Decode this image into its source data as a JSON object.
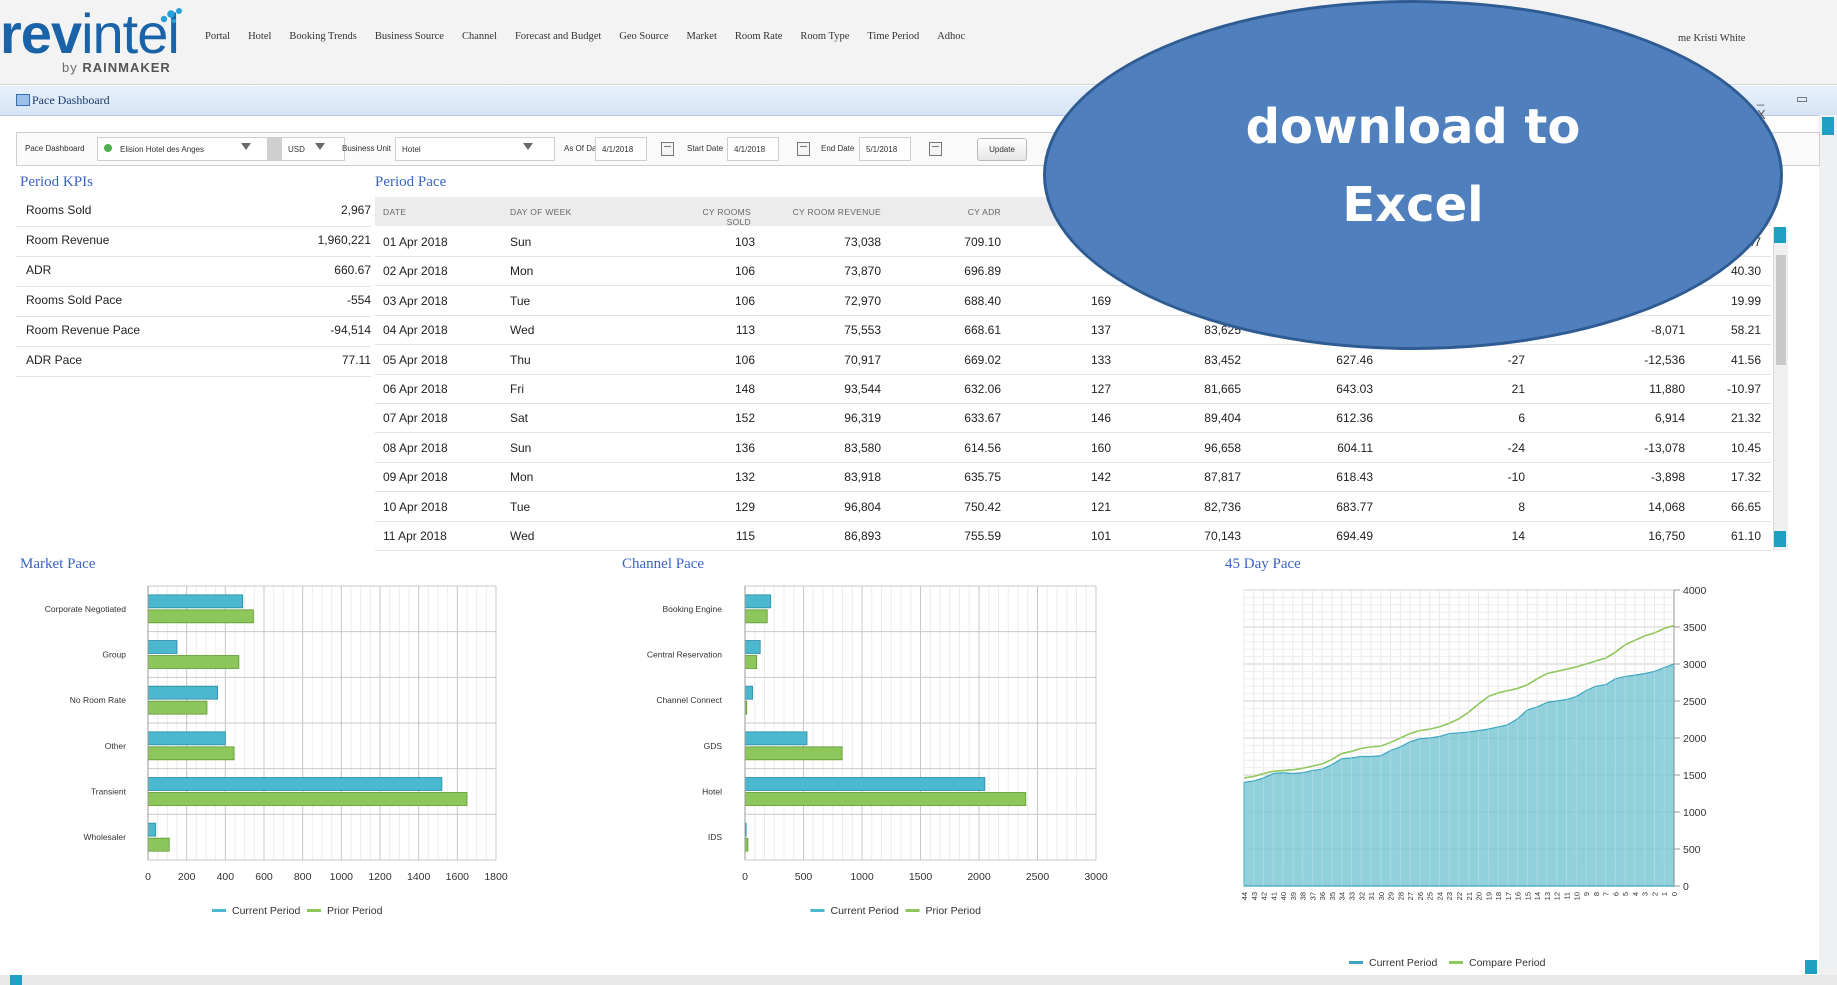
{
  "header": {
    "logo": {
      "brand_a": "rev",
      "brand_b": "intel",
      "by": "by",
      "company": "RAINMAKER"
    },
    "nav": [
      "Portal",
      "Hotel",
      "Booking Trends",
      "Business Source",
      "Channel",
      "Forecast and Budget",
      "Geo Source",
      "Market",
      "Room Rate",
      "Room Type",
      "Time Period",
      "Adhoc"
    ],
    "user": "me Kristi White"
  },
  "window": {
    "title": "Pace Dashboard",
    "controls": "_ ▭ X"
  },
  "filters": {
    "dashboard_label": "Pace Dashboard",
    "hotel": "Elision Hotel des Anges",
    "currency": "USD",
    "business_unit_label": "Business Unit",
    "business_unit": "Hotel",
    "as_of_label": "As Of Date",
    "as_of": "4/1/2018",
    "start_label": "Start Date",
    "start": "4/1/2018",
    "end_label": "End Date",
    "end": "5/1/2018",
    "update": "Update"
  },
  "callout": {
    "line1": "download to",
    "line2": "Excel"
  },
  "kpi": {
    "title": "Period KPIs",
    "rows": [
      {
        "k": "Rooms Sold",
        "v": "2,967"
      },
      {
        "k": "Room Revenue",
        "v": "1,960,221"
      },
      {
        "k": "ADR",
        "v": "660.67"
      },
      {
        "k": "Rooms Sold Pace",
        "v": "-554"
      },
      {
        "k": "Room Revenue Pace",
        "v": "-94,514"
      },
      {
        "k": "ADR Pace",
        "v": "77.11"
      }
    ]
  },
  "pace": {
    "title": "Period Pace",
    "headers": [
      "DATE",
      "DAY OF WEEK",
      "CY ROOMS SOLD",
      "CY ROOM REVENUE",
      "CY ADR"
    ],
    "rows": [
      {
        "date": "01 Apr 2018",
        "dow": "Sun",
        "rooms": "103",
        "rev": "73,038",
        "adr": "709.10",
        "c6": "",
        "c7": "",
        "c8": "",
        "c9": "",
        "c10": "",
        "c11": ".47"
      },
      {
        "date": "02 Apr 2018",
        "dow": "Mon",
        "rooms": "106",
        "rev": "73,870",
        "adr": "696.89",
        "c6": "",
        "c7": "",
        "c8": "",
        "c9": "",
        "c10": "",
        "c11": "40.30"
      },
      {
        "date": "03 Apr 2018",
        "dow": "Tue",
        "rooms": "106",
        "rev": "72,970",
        "adr": "688.40",
        "c6": "169",
        "c7": "",
        "c8": "",
        "c9": "",
        "c10": "",
        "c11": "19.99"
      },
      {
        "date": "04 Apr 2018",
        "dow": "Wed",
        "rooms": "113",
        "rev": "75,553",
        "adr": "668.61",
        "c6": "137",
        "c7": "83,625",
        "c8": "",
        "c9": "",
        "c10": "-8,071",
        "c11": "58.21"
      },
      {
        "date": "05 Apr 2018",
        "dow": "Thu",
        "rooms": "106",
        "rev": "70,917",
        "adr": "669.02",
        "c6": "133",
        "c7": "83,452",
        "c8": "627.46",
        "c9": "-27",
        "c10": "-12,536",
        "c11": "41.56"
      },
      {
        "date": "06 Apr 2018",
        "dow": "Fri",
        "rooms": "148",
        "rev": "93,544",
        "adr": "632.06",
        "c6": "127",
        "c7": "81,665",
        "c8": "643.03",
        "c9": "21",
        "c10": "11,880",
        "c11": "-10.97"
      },
      {
        "date": "07 Apr 2018",
        "dow": "Sat",
        "rooms": "152",
        "rev": "96,319",
        "adr": "633.67",
        "c6": "146",
        "c7": "89,404",
        "c8": "612.36",
        "c9": "6",
        "c10": "6,914",
        "c11": "21.32"
      },
      {
        "date": "08 Apr 2018",
        "dow": "Sun",
        "rooms": "136",
        "rev": "83,580",
        "adr": "614.56",
        "c6": "160",
        "c7": "96,658",
        "c8": "604.11",
        "c9": "-24",
        "c10": "-13,078",
        "c11": "10.45"
      },
      {
        "date": "09 Apr 2018",
        "dow": "Mon",
        "rooms": "132",
        "rev": "83,918",
        "adr": "635.75",
        "c6": "142",
        "c7": "87,817",
        "c8": "618.43",
        "c9": "-10",
        "c10": "-3,898",
        "c11": "17.32"
      },
      {
        "date": "10 Apr 2018",
        "dow": "Tue",
        "rooms": "129",
        "rev": "96,804",
        "adr": "750.42",
        "c6": "121",
        "c7": "82,736",
        "c8": "683.77",
        "c9": "8",
        "c10": "14,068",
        "c11": "66.65"
      },
      {
        "date": "11 Apr 2018",
        "dow": "Wed",
        "rooms": "115",
        "rev": "86,893",
        "adr": "755.59",
        "c6": "101",
        "c7": "70,143",
        "c8": "694.49",
        "c9": "14",
        "c10": "16,750",
        "c11": "61.10"
      }
    ]
  },
  "chart_data": [
    {
      "type": "bar",
      "orientation": "horizontal",
      "title": "Market Pace",
      "categories": [
        "Corporate Negotiated",
        "Group",
        "No Room Rate",
        "Other",
        "Transient",
        "Wholesaler"
      ],
      "series": [
        {
          "name": "Current Period",
          "color": "#4bb8cf",
          "values": [
            490,
            150,
            360,
            400,
            1520,
            40
          ]
        },
        {
          "name": "Prior Period",
          "color": "#8dc65a",
          "values": [
            545,
            470,
            305,
            445,
            1650,
            110
          ]
        }
      ],
      "xlim": [
        0,
        1800
      ],
      "xticks": [
        "0",
        "200",
        "400",
        "600",
        "800",
        "1000",
        "1200",
        "1400",
        "1600",
        "1800"
      ],
      "grid": true,
      "legend": "bottom"
    },
    {
      "type": "bar",
      "orientation": "horizontal",
      "title": "Channel Pace",
      "categories": [
        "Booking Engine",
        "Central Reservation",
        "Channel Connect",
        "GDS",
        "Hotel",
        "IDS"
      ],
      "series": [
        {
          "name": "Current Period",
          "color": "#4bb8cf",
          "values": [
            220,
            130,
            65,
            530,
            2050,
            10
          ]
        },
        {
          "name": "Prior Period",
          "color": "#8dc65a",
          "values": [
            190,
            100,
            15,
            830,
            2400,
            25
          ]
        }
      ],
      "xlim": [
        0,
        3000
      ],
      "xticks": [
        "0",
        "500",
        "1000",
        "1500",
        "2000",
        "2500",
        "3000"
      ],
      "grid": true,
      "legend": "bottom"
    },
    {
      "type": "area",
      "title": "45 Day Pace",
      "x": [
        "44",
        "43",
        "42",
        "41",
        "40",
        "39",
        "38",
        "37",
        "36",
        "35",
        "34",
        "33",
        "32",
        "31",
        "30",
        "29",
        "28",
        "27",
        "26",
        "25",
        "24",
        "23",
        "22",
        "21",
        "20",
        "19",
        "18",
        "17",
        "16",
        "15",
        "14",
        "13",
        "12",
        "11",
        "10",
        "9",
        "8",
        "7",
        "6",
        "5",
        "4",
        "3",
        "2",
        "1",
        "0"
      ],
      "series": [
        {
          "name": "Current Period",
          "color": "#7fc8d6",
          "style": "area",
          "values": [
            1400,
            1420,
            1460,
            1520,
            1530,
            1520,
            1530,
            1560,
            1580,
            1640,
            1720,
            1730,
            1750,
            1750,
            1760,
            1830,
            1880,
            1950,
            1990,
            2000,
            2020,
            2060,
            2070,
            2080,
            2100,
            2120,
            2150,
            2180,
            2260,
            2380,
            2420,
            2480,
            2500,
            2520,
            2560,
            2640,
            2700,
            2720,
            2800,
            2830,
            2850,
            2870,
            2900,
            2950,
            3000
          ]
        },
        {
          "name": "Compare Period",
          "color": "#8dc65a",
          "style": "line",
          "values": [
            1460,
            1480,
            1520,
            1550,
            1560,
            1570,
            1590,
            1620,
            1650,
            1710,
            1790,
            1820,
            1860,
            1880,
            1890,
            1940,
            2000,
            2060,
            2100,
            2120,
            2150,
            2200,
            2260,
            2350,
            2460,
            2560,
            2610,
            2640,
            2670,
            2720,
            2800,
            2870,
            2900,
            2930,
            2960,
            3000,
            3040,
            3080,
            3160,
            3260,
            3320,
            3380,
            3420,
            3480,
            3520
          ]
        }
      ],
      "ylim": [
        0,
        4000
      ],
      "yticks": [
        "0",
        "500",
        "1000",
        "1500",
        "2000",
        "2500",
        "3000",
        "3500",
        "4000"
      ],
      "grid": true,
      "legend": "bottom"
    }
  ]
}
